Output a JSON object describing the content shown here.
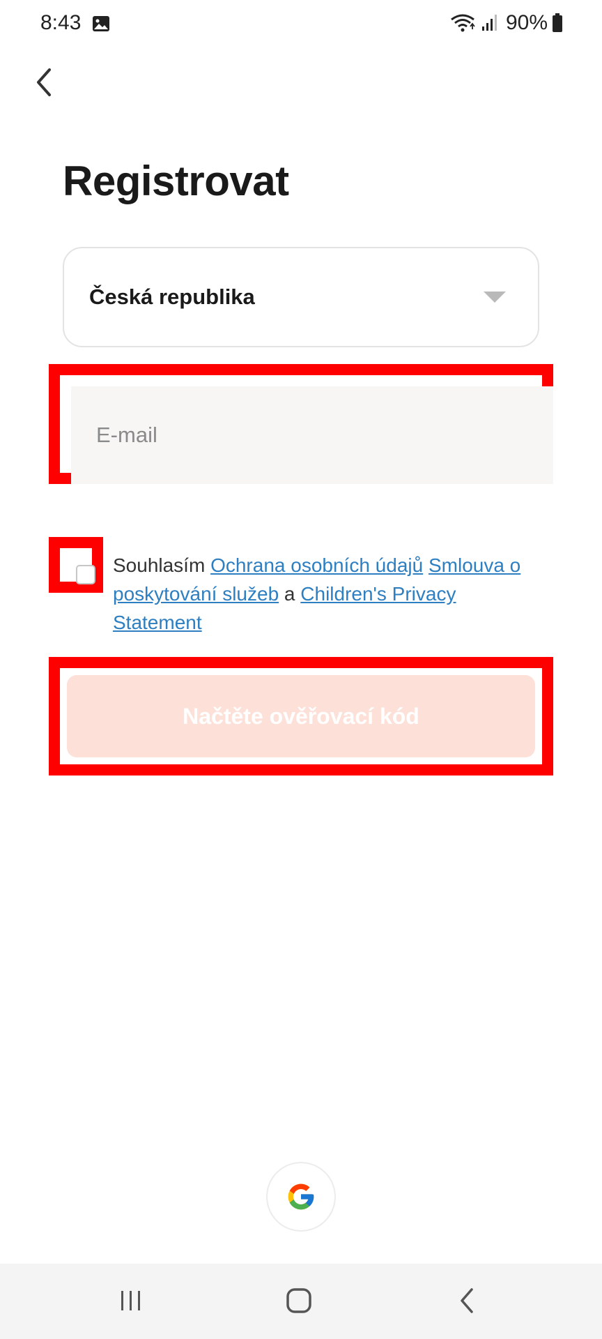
{
  "status_bar": {
    "time": "8:43",
    "battery": "90%",
    "icons": [
      "photo-icon",
      "wifi-icon",
      "signal-icon",
      "battery-icon"
    ]
  },
  "header": {
    "back_icon": "chevron-left-icon",
    "title": "Registrovat"
  },
  "country": {
    "selected": "Česká republika"
  },
  "email": {
    "value": "",
    "placeholder": "E-mail"
  },
  "agreement": {
    "prefix": "Souhlasím",
    "privacy_link": "Ochrana osobních údajů",
    "terms_link": "Smlouva o poskytování služeb",
    "conjunction": "a",
    "children_link": "Children's Privacy Statement",
    "checked": false
  },
  "submit": {
    "label": "Načtěte ověřovací kód"
  },
  "social": {
    "google_icon": "google-icon"
  },
  "nav_bar": {
    "icons": [
      "recent-apps-icon",
      "home-icon",
      "back-icon"
    ]
  },
  "colors": {
    "highlight": "#ff0000",
    "link": "#2d7fc1",
    "submit_disabled": "#fde0d8",
    "input_bg": "#f7f6f5"
  }
}
